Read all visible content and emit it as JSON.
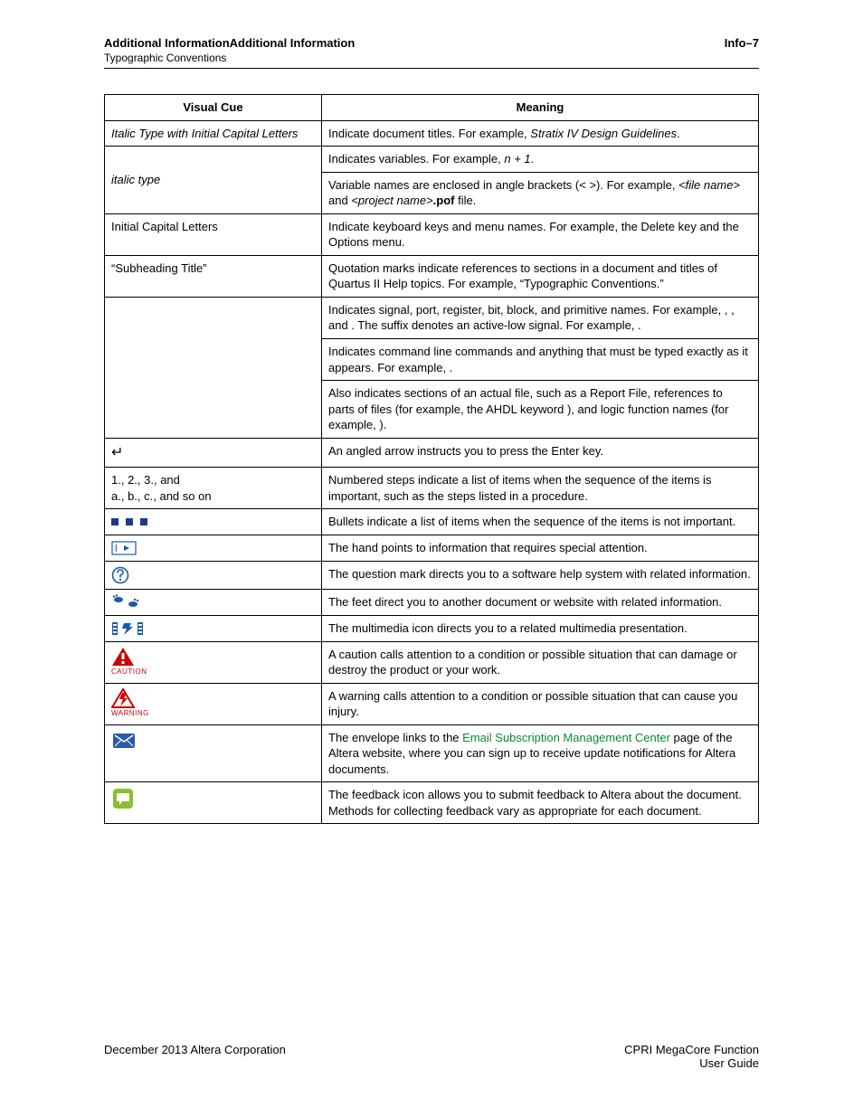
{
  "header": {
    "left_title": "Additional InformationAdditional Information",
    "left_subtitle": "Typographic Conventions",
    "right": "Info–7"
  },
  "table": {
    "col1": "Visual Cue",
    "col2": "Meaning",
    "rows": {
      "r1": {
        "cue": "Italic Type with Initial Capital Letters",
        "meaning_a": "Indicate document titles. For example, ",
        "meaning_b": "Stratix IV Design Guidelines",
        "meaning_c": "."
      },
      "r2": {
        "cue": "italic type",
        "m1a": "Indicates variables. For example, ",
        "m1b": "n + 1",
        "m1c": ".",
        "m2a": "Variable names are enclosed in angle brackets (< >). For example, ",
        "m2b": "<file name>",
        "m2c": " and ",
        "m2d": "<project name>",
        "m2e": ".pof",
        "m2f": " file."
      },
      "r3": {
        "cue": "Initial Capital Letters",
        "m": "Indicate keyboard keys and menu names. For example, the Delete key and the Options menu."
      },
      "r4": {
        "cue": "“Subheading Title”",
        "m": "Quotation marks indicate references to sections in a document and titles of Quartus II Help topics. For example, “Typographic Conventions.”"
      },
      "r5": {
        "m1": "Indicates signal, port, register, bit, block, and primitive names. For example,        ,         , and          . The suffix    denotes an active-low signal. For example,           .",
        "m2": "Indicates command line commands and anything that must be typed exactly as it appears. For example,                                .",
        "m3": "Also indicates sections of an actual file, such as a Report File, references to parts of files (for example, the AHDL keyword                    ), and logic function names (for example,        )."
      },
      "r6": {
        "cue": "↵",
        "m": "An angled arrow instructs you to press the Enter key."
      },
      "r7": {
        "cue1": "1., 2., 3., and",
        "cue2": "a., b., c., and so on",
        "m": "Numbered steps indicate a list of items when the sequence of the items is important, such as the steps listed in a procedure."
      },
      "r8": {
        "m": "Bullets indicate a list of items when the sequence of the items is not important."
      },
      "r9": {
        "m": "The hand points to information that requires special attention."
      },
      "r10": {
        "m": "The question mark directs you to a software help system with related information."
      },
      "r11": {
        "m": "The feet direct you to another document or website with related information."
      },
      "r12": {
        "m": "The multimedia icon directs you to a related multimedia presentation."
      },
      "r13": {
        "label": "CAUTION",
        "m": "A caution calls attention to a condition or possible situation that can damage or destroy the product or your work."
      },
      "r14": {
        "label": "WARNING",
        "m": "A warning calls attention to a condition or possible situation that can cause you injury."
      },
      "r15": {
        "m1": "The envelope links to the ",
        "link": "Email Subscription Management Center",
        "m2": " page of the Altera website, where you can sign up to receive update notifications for Altera documents."
      },
      "r16": {
        "m": "The feedback icon allows you to submit feedback to Altera about the document. Methods for collecting feedback vary as appropriate for each document."
      }
    }
  },
  "footer": {
    "left": "December 2013   Altera Corporation",
    "right1": "CPRI MegaCore Function",
    "right2": "User Guide"
  }
}
